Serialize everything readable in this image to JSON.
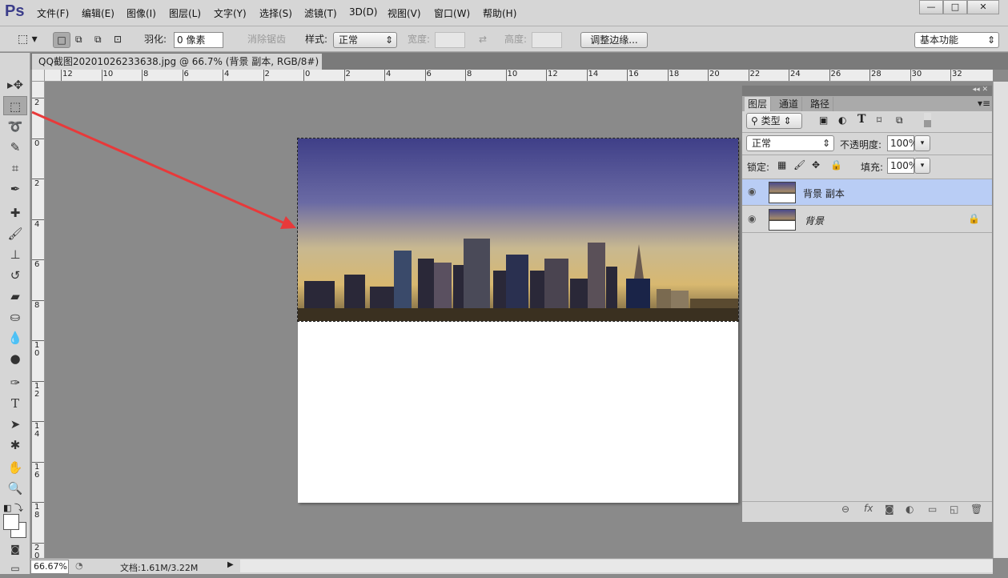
{
  "app": {
    "logo": "Ps"
  },
  "menu": [
    "文件(F)",
    "编辑(E)",
    "图像(I)",
    "图层(L)",
    "文字(Y)",
    "选择(S)",
    "滤镜(T)",
    "3D(D)",
    "视图(V)",
    "窗口(W)",
    "帮助(H)"
  ],
  "window_controls": {
    "minimize": "—",
    "maximize": "□",
    "close": "✕"
  },
  "options": {
    "feather_label": "羽化:",
    "feather_value": "0 像素",
    "antialias_label": "消除锯齿",
    "style_label": "样式:",
    "style_value": "正常",
    "width_label": "宽度:",
    "height_label": "高度:",
    "refine_edge": "调整边缘...",
    "workspace": "基本功能"
  },
  "document": {
    "tab_title": "QQ截图20201026233638.jpg @ 66.7% (背景 副本, RGB/8#) *",
    "close": "×"
  },
  "ruler": {
    "h": [
      "12",
      "10",
      "8",
      "6",
      "4",
      "2",
      "0",
      "2",
      "4",
      "6",
      "8",
      "10",
      "12",
      "14",
      "16",
      "18",
      "20",
      "22",
      "24",
      "26",
      "28",
      "30",
      "32"
    ],
    "v": [
      "2",
      "0",
      "2",
      "4",
      "6",
      "8",
      "10",
      "12",
      "14",
      "16",
      "18",
      "20"
    ]
  },
  "layers_panel": {
    "tabs": [
      "图层",
      "通道",
      "路径"
    ],
    "filter": "类型",
    "blend_mode": "正常",
    "opacity_label": "不透明度:",
    "opacity": "100%",
    "lock_label": "锁定:",
    "fill_label": "填充:",
    "fill": "100%",
    "layers": [
      {
        "name": "背景 副本",
        "selected": true
      },
      {
        "name": "背景",
        "locked": true
      }
    ]
  },
  "status": {
    "zoom": "66.67%",
    "doc_info": "文档:1.61M/3.22M"
  },
  "colors": {
    "accent": "#b9cdf5",
    "arrow": "#e8393a"
  }
}
